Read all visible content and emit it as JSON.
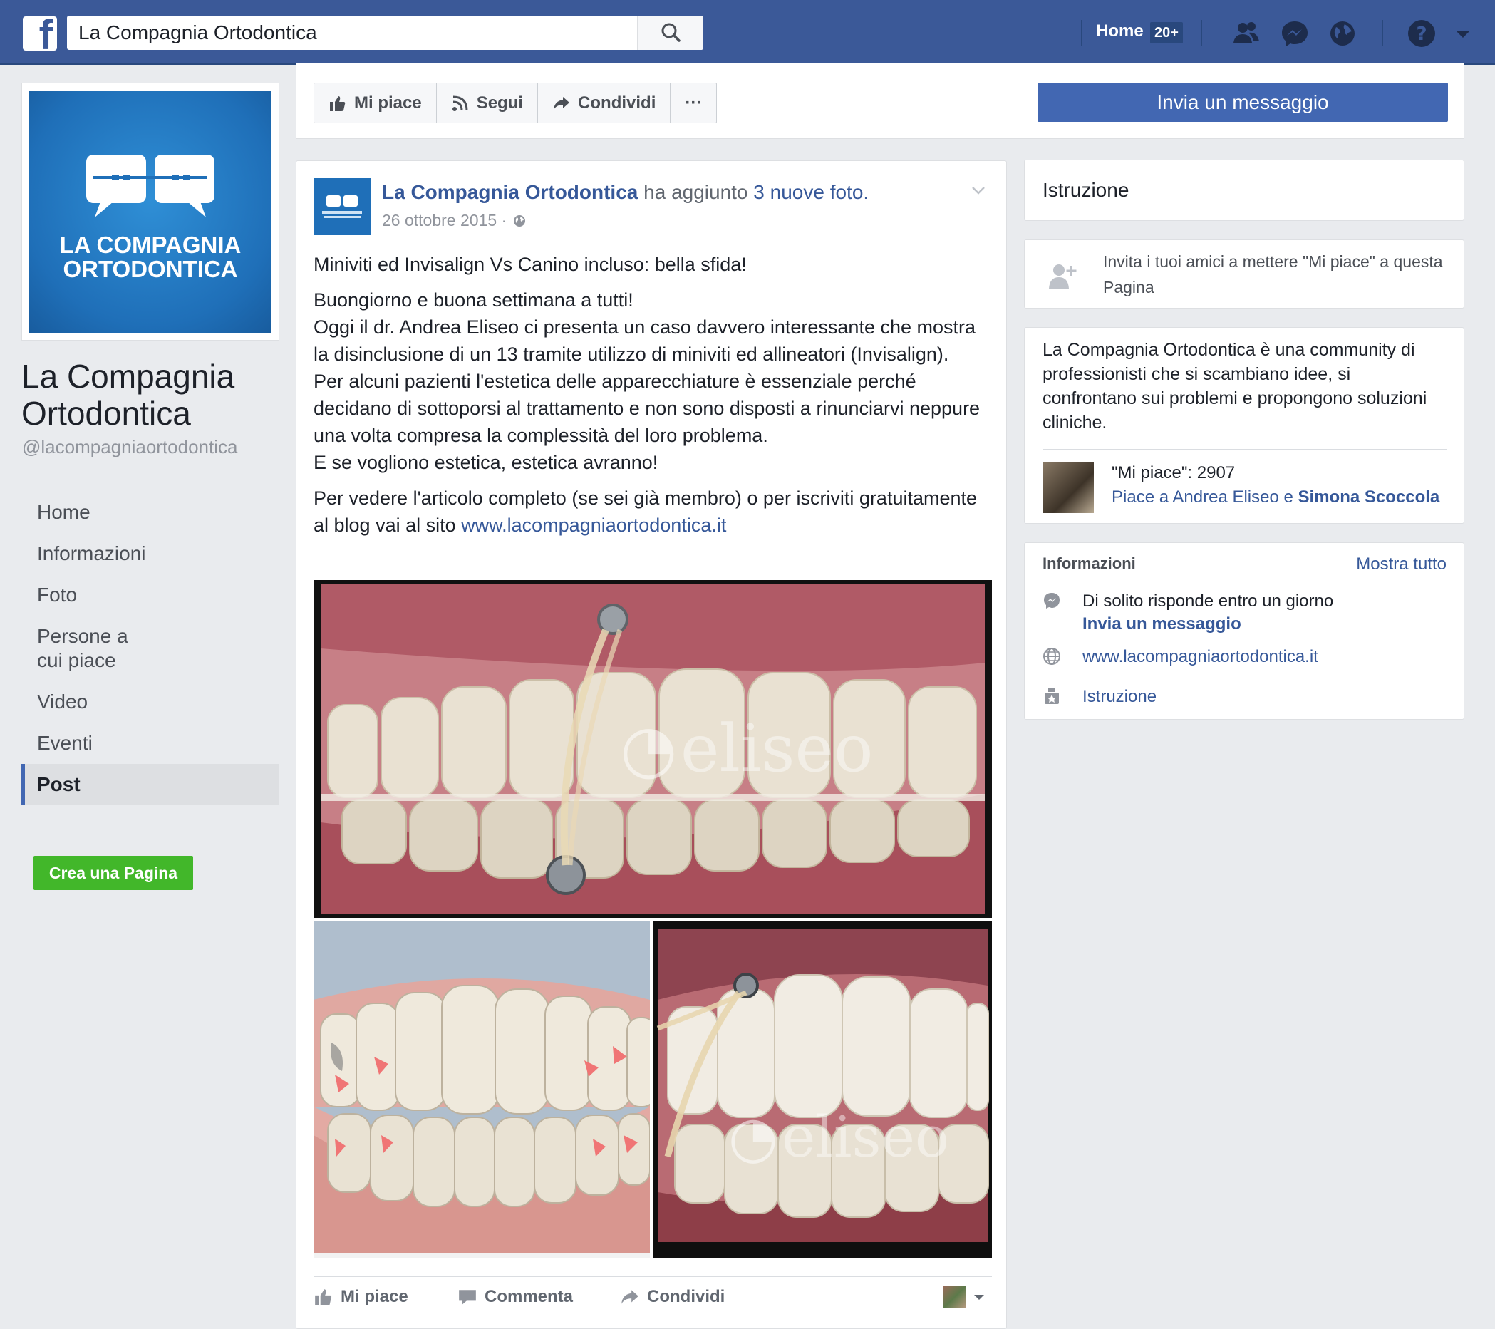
{
  "topbar": {
    "logo_letter": "f",
    "search_value": "La Compagnia Ortodontica",
    "home_label": "Home",
    "home_badge": "20+"
  },
  "left": {
    "logo_line1": "LA COMPAGNIA",
    "logo_line2": "ORTODONTICA",
    "page_name": "La Compagnia Ortodontica",
    "handle": "@lacompagniaortodontica",
    "nav": [
      "Home",
      "Informazioni",
      "Foto",
      "Persone a cui piace",
      "Video",
      "Eventi",
      "Post"
    ],
    "active_nav": "Post",
    "create_page": "Crea una Pagina"
  },
  "actions": {
    "like": "Mi piace",
    "follow": "Segui",
    "share": "Condividi",
    "more": "···",
    "message": "Invia un messaggio"
  },
  "post": {
    "author": "La Compagnia Ortodontica",
    "action_text": "ha aggiunto",
    "photos_link": "3 nuove foto.",
    "date": "26 ottobre 2015 ·",
    "title": "Miniviti ed Invisalign Vs Canino incluso: bella sfida!",
    "body_lines": [
      "Buongiorno e buona settimana a tutti!",
      "Oggi il dr. Andrea Eliseo ci presenta un caso davvero interessante che mostra la disinclusione di un 13 tramite utilizzo di miniviti ed allineatori (Invisalign). Per alcuni pazienti l'estetica delle apparecchiature è essenziale perché decidano di sottoporsi al trattamento e non sono disposti a rinunciarvi neppure una volta compresa la complessità del loro problema.",
      "E se vogliono estetica, estetica avranno!"
    ],
    "cta_text": "Per vedere l'articolo completo (se sei già membro) o per iscriviti gratuitamente al blog vai al sito",
    "cta_link": "www.lacompagniaortodontica.it",
    "watermark": "eliseo",
    "footer": {
      "like": "Mi piace",
      "comment": "Commenta",
      "share": "Condividi"
    }
  },
  "right": {
    "category": "Istruzione",
    "invite": "Invita i tuoi amici a mettere \"Mi piace\" a questa Pagina",
    "about": "La Compagnia Ortodontica è una community di professionisti che si scambiano idee, si confrontano sui problemi e propongono soluzioni cliniche.",
    "likes_count": "\"Mi piace\": 2907",
    "likes_friends_prefix": "Piace a Andrea Eliseo e",
    "likes_friends_name": "Simona Scoccola",
    "info": {
      "title": "Informazioni",
      "show_all": "Mostra tutto",
      "response": "Di solito risponde entro un giorno",
      "send_message": "Invia un messaggio",
      "website": "www.lacompagniaortodontica.it",
      "category": "Istruzione"
    }
  },
  "colors": {
    "brand_blue": "#3b5998",
    "button_blue": "#4267b2",
    "link": "#365899",
    "green": "#42b72a"
  }
}
